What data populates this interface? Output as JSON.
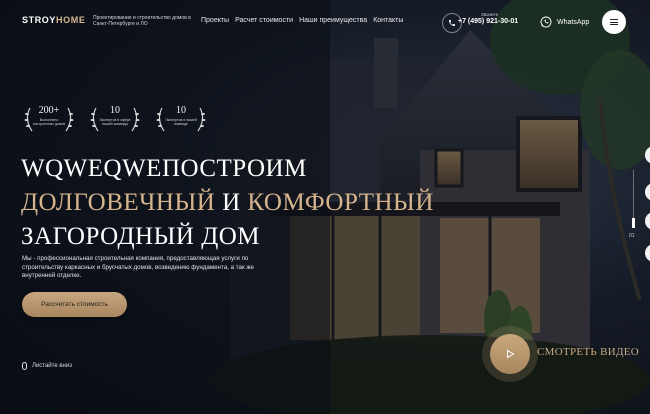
{
  "header": {
    "logo_main": "STROY",
    "logo_accent": "HOME",
    "tagline": "Проектирование и строительство домов в Санкт-Петербурге и ЛО",
    "nav": [
      "Проекты",
      "Расчет стоимости",
      "Наши преимущества",
      "Контакты"
    ],
    "phone_label": "Звоните",
    "phone": "+7 (495) 921-30-01",
    "whatsapp": "WhatsApp",
    "menu_icon": "hamburger-icon"
  },
  "awards": [
    {
      "number": "200+",
      "caption": "Выполнено построенных домов"
    },
    {
      "number": "10",
      "caption": "Экспертов в сфере нашей команды"
    },
    {
      "number": "10",
      "caption": "Экспертов в нашей команде"
    }
  ],
  "hero": {
    "title_line1": "WQWEQWEПОСТРОИМ",
    "title_gold1": "ДОЛГОВЕЧНЫЙ",
    "title_and": " И ",
    "title_gold2": "КОМФОРТНЫЙ",
    "title_line3": "ЗАГОРОДНЫЙ ДОМ",
    "description": "Мы - профессиональная строительная компания, предоставляющая услуги по строительству каркасных и брусчатых домов, возведению фундамента, а так же внутренней отделке.",
    "cta": "Рассчитать стоимость",
    "scroll_hint": "Листайте вниз"
  },
  "video": {
    "label": "СМОТРЕТЬ ВИДЕО",
    "play_icon": "play-icon"
  },
  "slider": {
    "current": "01"
  },
  "colors": {
    "accent": "#d6b58d",
    "background": "#0d1117"
  }
}
